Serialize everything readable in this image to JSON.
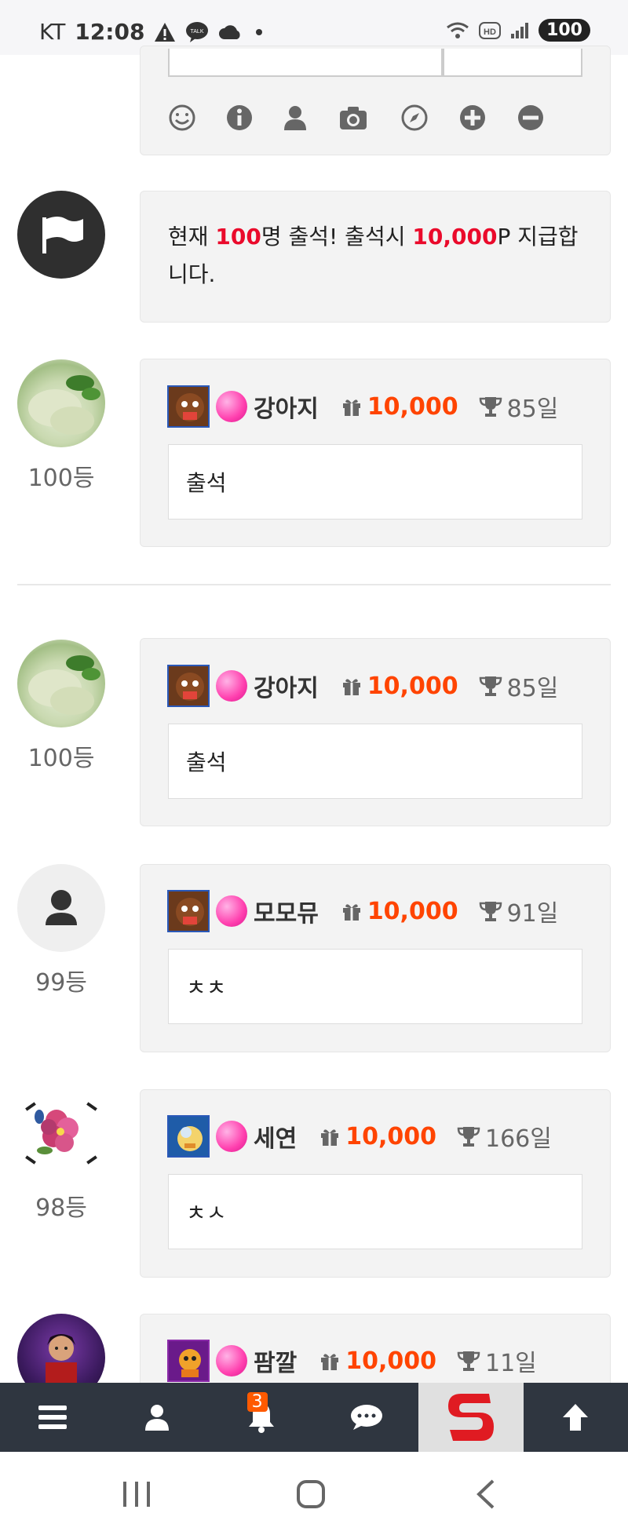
{
  "status": {
    "carrier": "KT",
    "time": "12:08",
    "battery": "100"
  },
  "notice": {
    "part1": "현재 ",
    "count": "100",
    "part2": "명 출석! 출석시 ",
    "points": "10,000",
    "part3": "P 지급합",
    "line2": "니다."
  },
  "entries": [
    {
      "rank": "100등",
      "nickname": "강아지",
      "points": "10,000",
      "days": "85일",
      "message": "출석"
    },
    {
      "rank": "100등",
      "nickname": "강아지",
      "points": "10,000",
      "days": "85일",
      "message": "출석"
    },
    {
      "rank": "99등",
      "nickname": "모모뮤",
      "points": "10,000",
      "days": "91일",
      "message": "ㅊㅊ"
    },
    {
      "rank": "98등",
      "nickname": "세연",
      "points": "10,000",
      "days": "166일",
      "message": "ㅊㅅ"
    },
    {
      "rank": "",
      "nickname": "팜깔",
      "points": "10,000",
      "days": "11일",
      "message": ""
    }
  ],
  "bottom_nav": {
    "notification_count": "3"
  },
  "toolbar_icons": [
    "smile-icon",
    "info-icon",
    "user-icon",
    "camera-icon",
    "compass-icon",
    "plus-circle-icon",
    "minus-circle-icon"
  ]
}
